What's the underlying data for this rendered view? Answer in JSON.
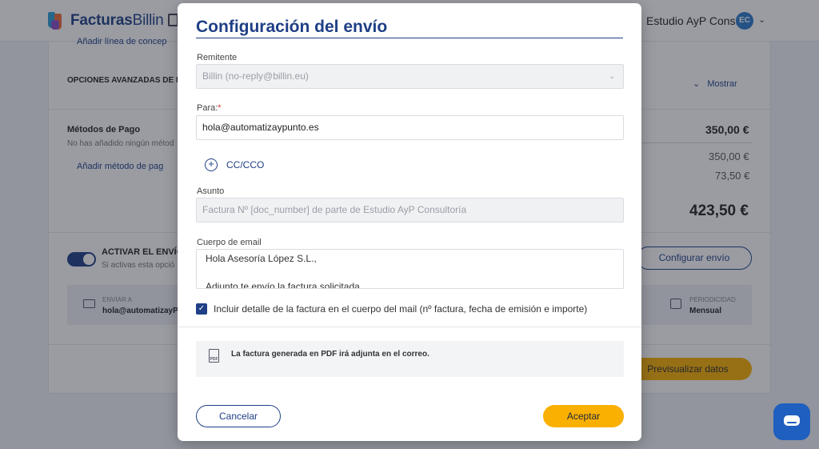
{
  "header": {
    "logo_text_bold": "Facturas",
    "logo_text_light": "Billin",
    "company": "Estudio AyP Cons...",
    "avatar_initials": "EC"
  },
  "background": {
    "add_line_partial": "Añadir línea de concep",
    "advanced_options": "OPCIONES AVANZADAS DE F",
    "show_label": "Mostrar",
    "payment_methods_title": "Métodos de Pago",
    "payment_methods_empty": "No has añadido ningún métod",
    "add_payment_method": "Añadir método de pag",
    "amount_subtotal": "350,00 €",
    "amount_base": "350,00 €",
    "amount_tax": "73,50 €",
    "amount_total": "423,50 €",
    "activate_send": "ACTIVAR EL ENVÍO",
    "activate_hint": "Si activas esta opció",
    "configure_send": "Configurar envío",
    "send_to_label": "ENVIAR A",
    "send_to_value": "hola@automatizayP",
    "periodicity_label": "PERIODICIDAD",
    "periodicity_value": "Mensual",
    "preview_data": "Previsualizar datos"
  },
  "modal": {
    "title": "Configuración del envío",
    "sender_label": "Remitente",
    "sender_value": "Billin (no-reply@billin.eu)",
    "to_label": "Para:",
    "to_required_mark": "*",
    "to_value": "hola@automatizaypunto.es",
    "cc_label": "CC/CCO",
    "subject_label": "Asunto",
    "subject_value": "Factura Nº [doc_number] de parte de Estudio AyP Consultoría",
    "body_label": "Cuerpo de email",
    "body_lines": [
      "Hola Asesoría López S.L.,",
      "Adjunto te envío la factura solicitada."
    ],
    "include_detail_checked": true,
    "include_detail_label": "Incluir detalle de la factura en el cuerpo del mail (nº factura, fecha de emisión e importe)",
    "pdf_icon_text": "PDF",
    "pdf_notice": "La factura generada en PDF irá adjunta en el correo.",
    "cancel_label": "Cancelar",
    "accept_label": "Aceptar"
  },
  "colors": {
    "brand_blue": "#1f3f86",
    "accent_yellow": "#f9b000",
    "required_red": "#e0362c"
  },
  "icons": [
    "logo-icon",
    "document-icon",
    "chevron-down-icon",
    "plus-circle-icon",
    "checkbox-checked-icon",
    "pdf-icon",
    "mail-icon",
    "calendar-icon",
    "chat-icon"
  ]
}
